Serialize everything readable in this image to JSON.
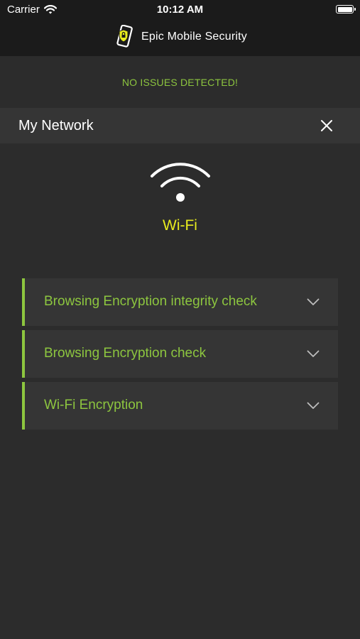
{
  "status_bar": {
    "carrier": "Carrier",
    "time": "10:12 AM",
    "icons": [
      "wifi-signal-icon",
      "battery-icon"
    ]
  },
  "app": {
    "title": "Epic Mobile Security",
    "logo_icon": "shield-phone-logo-icon"
  },
  "status": {
    "message": "NO ISSUES DETECTED!"
  },
  "section": {
    "title": "My Network",
    "close_icon": "close-icon"
  },
  "network": {
    "icon": "wifi-icon",
    "name": "Wi-Fi"
  },
  "checks": [
    {
      "label": "Browsing Encryption integrity check",
      "icon": "chevron-down-icon"
    },
    {
      "label": "Browsing Encryption check",
      "icon": "chevron-down-icon"
    },
    {
      "label": "Wi-Fi Encryption",
      "icon": "chevron-down-icon"
    }
  ],
  "colors": {
    "accent_green": "#8dc63f",
    "network_yellow": "#e8ec1e",
    "background": "#2c2c2c",
    "header": "#1b1b1b",
    "panel": "#353535"
  }
}
